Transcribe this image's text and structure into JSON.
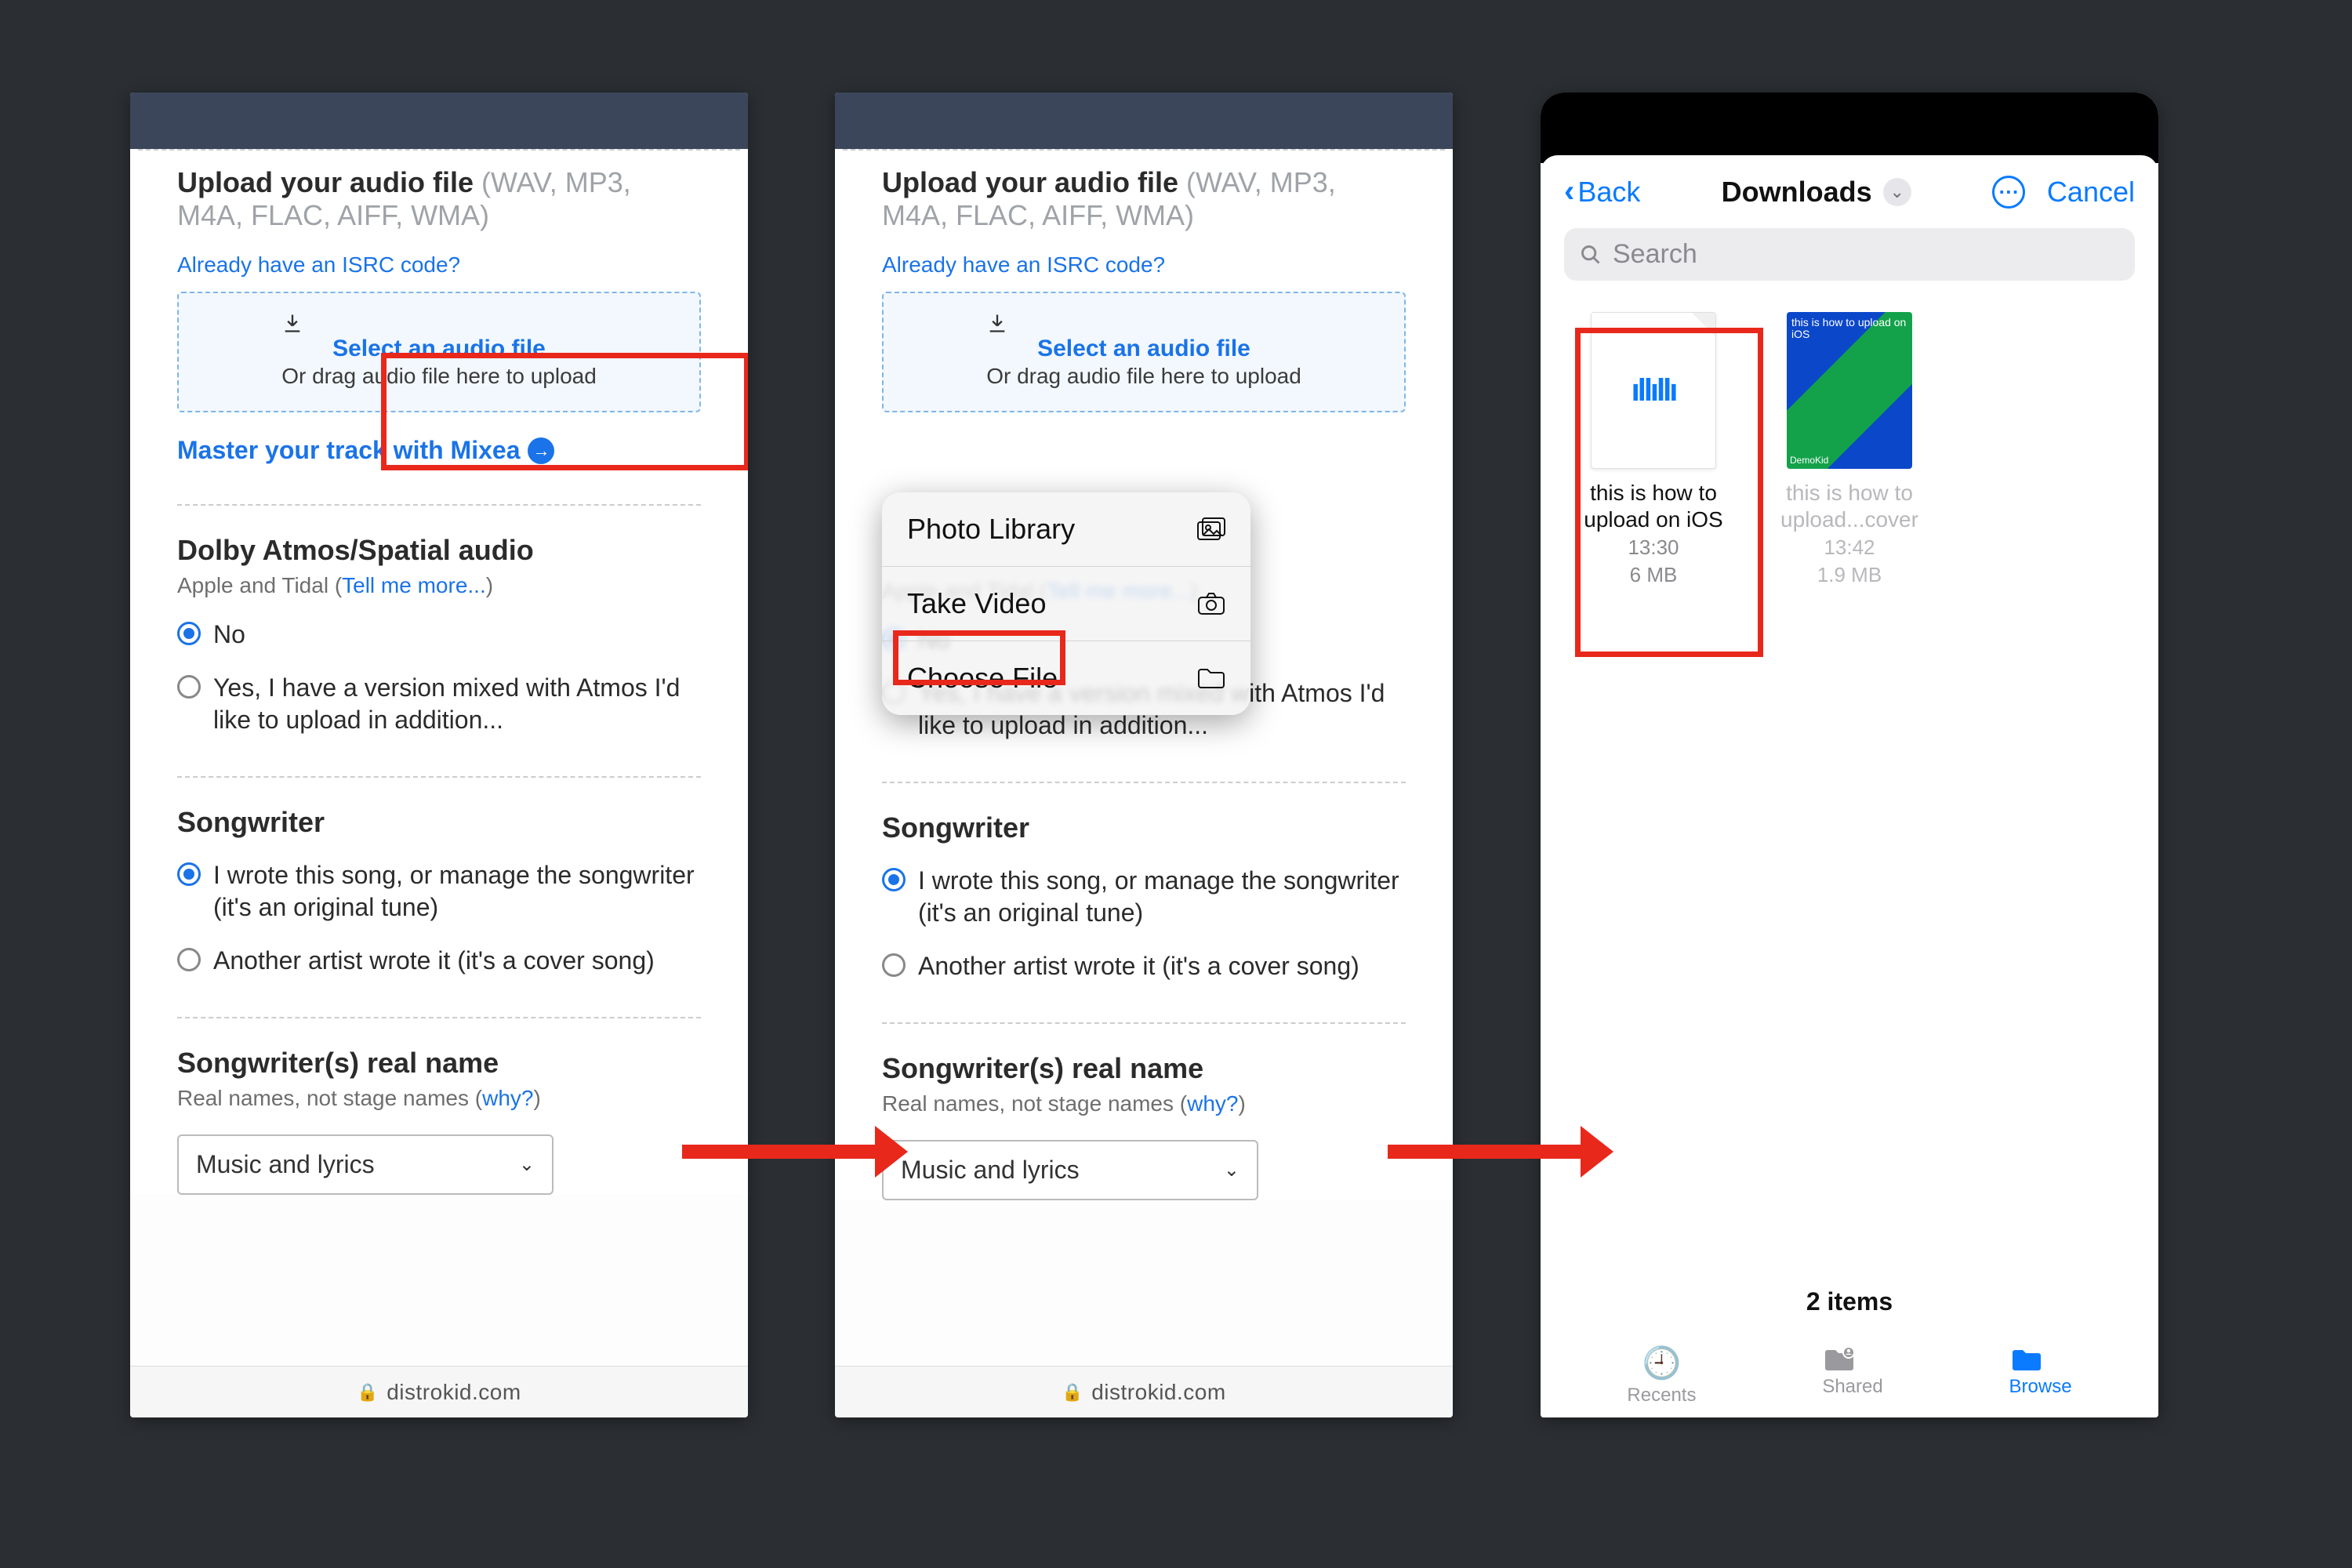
{
  "panel": {
    "upload_heading": "Upload your audio file",
    "upload_formats": " (WAV, MP3, M4A, FLAC, AIFF, WMA)",
    "isrc_link": "Already have an ISRC code?",
    "dz_select": "Select an audio file",
    "dz_drag": "Or drag audio file here to upload",
    "mixea": "Master your track with Mixea",
    "dolby_heading": "Dolby Atmos/Spatial audio",
    "dolby_sub_prefix": "Apple and Tidal (",
    "dolby_sub_link": "Tell me more...",
    "dolby_sub_suffix": ")",
    "dolby_no": "No",
    "dolby_yes": "Yes, I have a version mixed with Atmos I'd like to upload in addition...",
    "songwriter_heading": "Songwriter",
    "sw_opt1": "I wrote this song, or manage the songwriter (it's an original tune)",
    "sw_opt2": "Another artist wrote it (it's a cover song)",
    "realname_heading": "Songwriter(s) real name",
    "realname_sub_prefix": "Real names, not stage names (",
    "realname_sub_link": "why?",
    "realname_sub_suffix": ")",
    "select_value": "Music and lyrics",
    "domain": "distrokid.com"
  },
  "ios_menu": {
    "photo": "Photo Library",
    "video": "Take Video",
    "choose": "Choose File"
  },
  "picker": {
    "back": "Back",
    "title": "Downloads",
    "cancel": "Cancel",
    "search_placeholder": "Search",
    "file1_name": "this is how to upload on iOS",
    "file1_time": "13:30",
    "file1_size": "6 MB",
    "file2_name": "this is how to upload...cover",
    "file2_time": "13:42",
    "file2_size": "1.9 MB",
    "thumb_overlay": "this is how to upload on iOS",
    "thumb_badge": "DemoKid",
    "items_count": "2 items",
    "tab_recents": "Recents",
    "tab_shared": "Shared",
    "tab_browse": "Browse"
  }
}
